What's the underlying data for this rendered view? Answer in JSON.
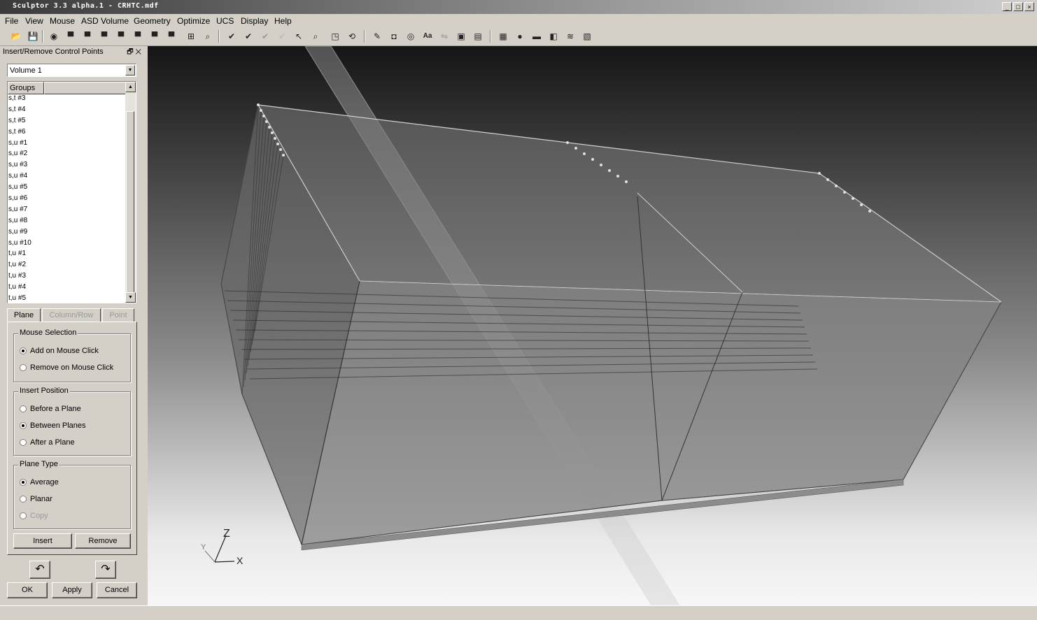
{
  "window": {
    "title": "Sculptor 3.3 alpha.1 - CRHTC.mdf",
    "min_label": "_",
    "max_label": "□",
    "close_label": "×"
  },
  "menu": [
    "File",
    "View",
    "Mouse",
    "ASD Volume",
    "Geometry",
    "Optimize",
    "UCS",
    "Display",
    "Help"
  ],
  "toolbar_icons": [
    "open-icon",
    "save-icon",
    "eye-icon",
    "view-1-icon",
    "view-2-icon",
    "view-3-icon",
    "view-4-icon",
    "view-5-icon",
    "view-6-icon",
    "view-7-icon",
    "grid-icon",
    "zoom-icon",
    "check-icon",
    "check-alt-icon",
    "check-dim-icon",
    "check-disabled-icon",
    "pointer-icon",
    "zoom-select-icon",
    "fit-icon",
    "rotate-icon",
    "pen-icon",
    "camera-icon",
    "target-icon",
    "text-icon",
    "mirror-icon",
    "layer-icon",
    "stack-icon",
    "table-icon",
    "sphere-icon",
    "car-icon",
    "export-icon",
    "wave-icon",
    "hatch-icon"
  ],
  "panel": {
    "title": "Insert/Remove Control Points",
    "dock_label": "🗗",
    "close_label": "✕",
    "volume_combo": "Volume 1",
    "list_header": "Groups",
    "groups": [
      "s,t #3",
      "s,t #4",
      "s,t #5",
      "s,t #6",
      "s,u #1",
      "s,u #2",
      "s,u #3",
      "s,u #4",
      "s,u #5",
      "s,u #6",
      "s,u #7",
      "s,u #8",
      "s,u #9",
      "s,u #10",
      "t,u #1",
      "t,u #2",
      "t,u #3",
      "t,u #4",
      "t,u #5"
    ],
    "tabs": [
      {
        "label": "Plane",
        "active": true
      },
      {
        "label": "Column/Row",
        "active": false
      },
      {
        "label": "Point",
        "active": false
      }
    ],
    "mouse_selection": {
      "title": "Mouse Selection",
      "options": [
        {
          "label": "Add on Mouse Click",
          "checked": true
        },
        {
          "label": "Remove on Mouse Click",
          "checked": false
        }
      ]
    },
    "insert_position": {
      "title": "Insert Position",
      "options": [
        {
          "label": "Before a Plane",
          "checked": false
        },
        {
          "label": "Between Planes",
          "checked": true
        },
        {
          "label": "After a Plane",
          "checked": false
        }
      ]
    },
    "plane_type": {
      "title": "Plane Type",
      "options": [
        {
          "label": "Average",
          "checked": true
        },
        {
          "label": "Planar",
          "checked": false
        },
        {
          "label": "Copy",
          "checked": false,
          "disabled": true
        }
      ]
    },
    "insert_button": "Insert",
    "remove_button": "Remove",
    "undo_label": "↶",
    "redo_label": "↷",
    "ok_button": "OK",
    "apply_button": "Apply",
    "cancel_button": "Cancel"
  },
  "axes": {
    "x": "X",
    "y": "Y",
    "z": "Z"
  }
}
